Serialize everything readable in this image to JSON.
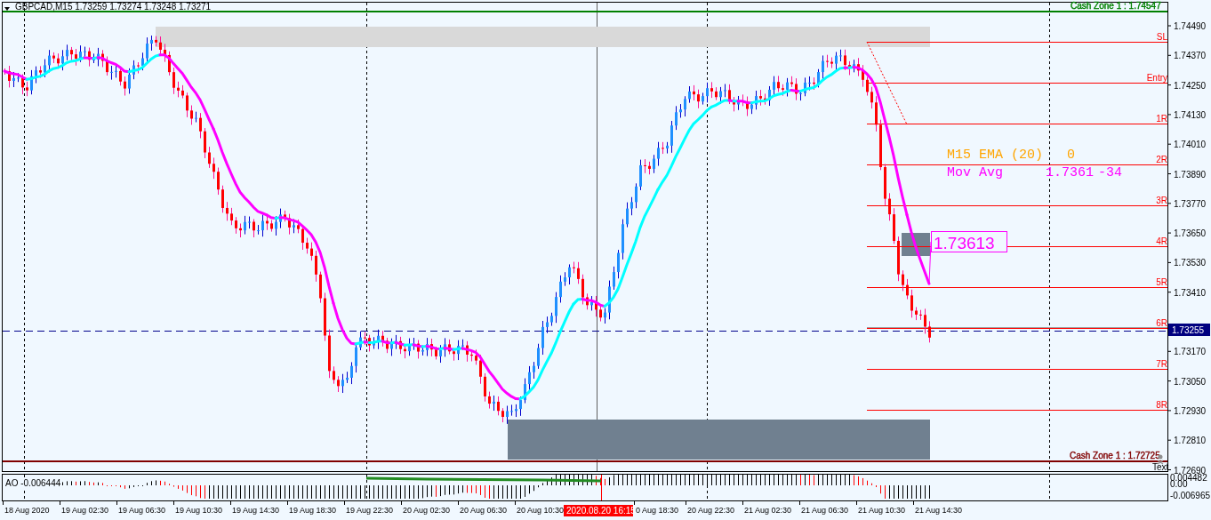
{
  "header": {
    "symbol_info": "GBPCAD,M15  1.73259 1.73274 1.73248 1.73271"
  },
  "cash_zones": [
    {
      "kind": "top",
      "label": "Cash Zone 1 : 1.74547",
      "color": "#008000"
    },
    {
      "kind": "bottom",
      "label": "Cash Zone 1 : 1.72725",
      "color": "#800000"
    }
  ],
  "levels": [
    {
      "label": "SL"
    },
    {
      "label": "Entry"
    },
    {
      "label": "1R"
    },
    {
      "label": "2R"
    },
    {
      "label": "3R"
    },
    {
      "label": "4R"
    },
    {
      "label": "5R"
    },
    {
      "label": "6R"
    },
    {
      "label": "7R"
    },
    {
      "label": "8R"
    }
  ],
  "legend": [
    {
      "texts": [
        "M15 EMA (20)",
        "0"
      ],
      "color": "#ffa500"
    },
    {
      "texts": [
        "Mov Avg",
        "1.7361",
        "-34"
      ],
      "color": "#ff00ff"
    }
  ],
  "ma_label": "1.73613",
  "text_object": "Text",
  "price_axis": {
    "labels": [
      "1.74490",
      "1.74370",
      "1.74250",
      "1.74130",
      "1.74010",
      "1.73890",
      "1.73770",
      "1.73650",
      "1.73530",
      "1.73410",
      "1.73170",
      "1.73050",
      "1.72930",
      "1.72810",
      "1.72690"
    ],
    "current_price": "1.73255"
  },
  "indicator": {
    "label": "AO -0.006444",
    "axis_labels": [
      "0.004482",
      "0.00",
      "-0.006965"
    ]
  },
  "time_axis": {
    "labels": [
      "18 Aug 2020",
      "19 Aug 02:30",
      "19 Aug 06:30",
      "19 Aug 10:30",
      "19 Aug 14:30",
      "19 Aug 18:30",
      "19 Aug 22:30",
      "20 Aug 02:30",
      "20 Aug 06:30",
      "20 Aug 10:30",
      "0 Aug 18:30",
      "20 Aug 22:30",
      "21 Aug 02:30",
      "21 Aug 06:30",
      "21 Aug 10:30",
      "21 Aug 14:30"
    ],
    "cursor_time": "2020.08.20 16:15"
  }
}
